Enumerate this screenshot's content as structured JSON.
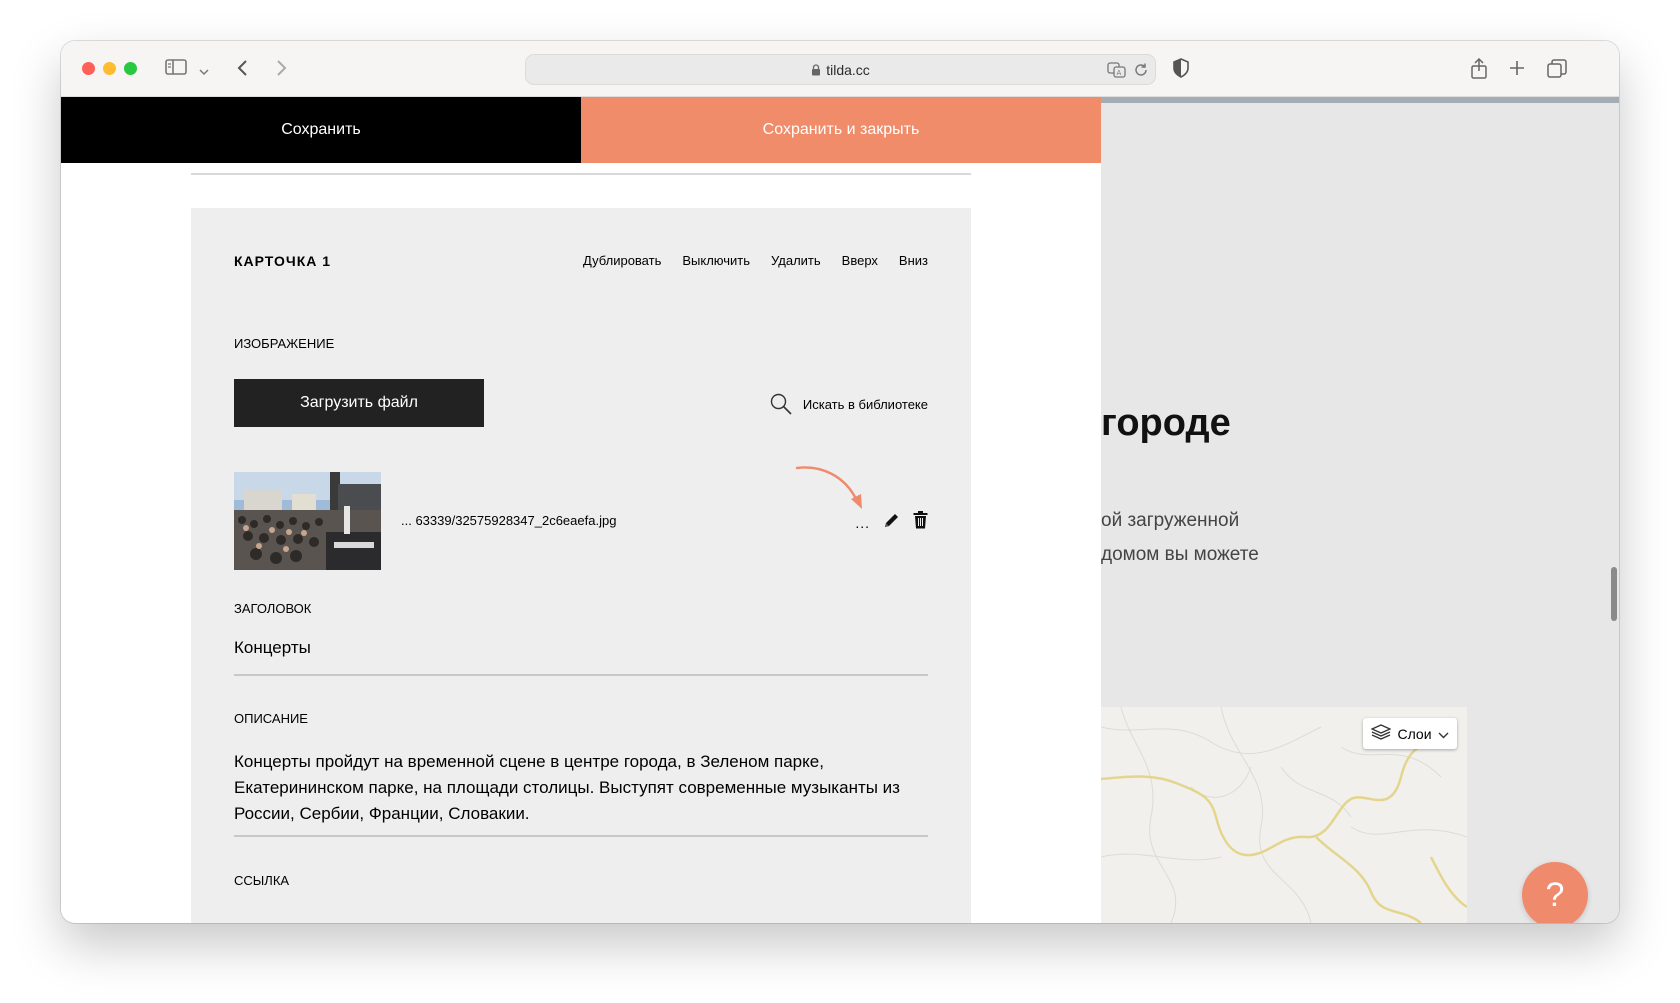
{
  "browser": {
    "url": "tilda.cc"
  },
  "toolbar": {
    "save_label": "Сохранить",
    "save_close_label": "Сохранить и закрыть"
  },
  "card": {
    "title": "КАРТОЧКА 1",
    "actions": [
      "Дублировать",
      "Выключить",
      "Удалить",
      "Вверх",
      "Вниз"
    ],
    "image_label": "ИЗОБРАЖЕНИЕ",
    "upload_label": "Загрузить файл",
    "library_label": "Искать в библиотеке",
    "file_name": "... 63339/32575928347_2c6eaefa.jpg",
    "file_more": "...",
    "title_label": "ЗАГОЛОВОК",
    "title_value": "Концерты",
    "description_label": "ОПИСАНИЕ",
    "description_value": "Концерты пройдут на временной сцене в центре города, в Зеленом парке, Екатерининском парке, на площади столицы. Выступят современные музыканты из России, Сербии, Франции, Словакии.",
    "link_label": "ССЫЛКА"
  },
  "preview": {
    "heading": "городе",
    "text_line1": "ой загруженной",
    "text_line2": "домом вы можете",
    "map_layers_label": "Слои",
    "help_label": "?"
  },
  "colors": {
    "accent": "#f08c6a",
    "dark": "#000000",
    "card_bg": "#eeeeee"
  }
}
